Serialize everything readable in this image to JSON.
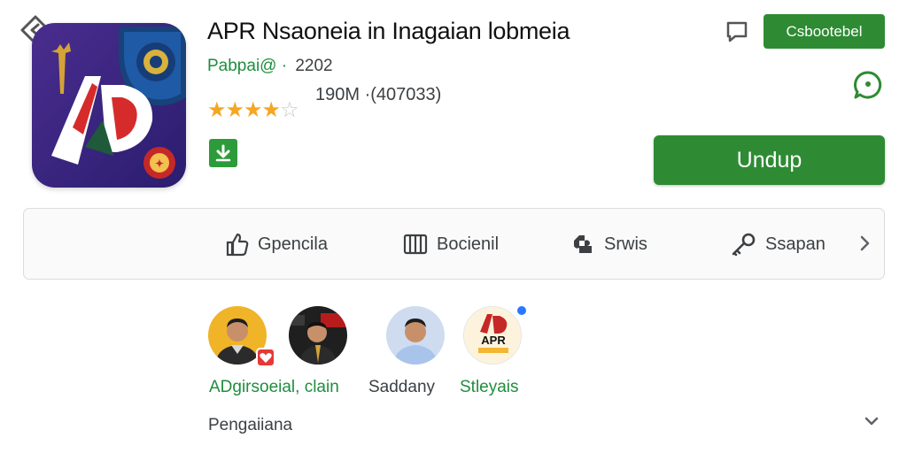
{
  "app": {
    "title": "APR Nsaoneia in Inagaian lobmeia",
    "developer": "Pabpai@",
    "developer_separator": "·",
    "year": "2202",
    "rating_stars": 4.5,
    "reviews": "190M ·(407033)",
    "icon_text": "AD"
  },
  "header": {
    "top_button_label": "Csbootebel",
    "main_button_label": "Undup"
  },
  "actions": [
    {
      "label": "Gpencila",
      "icon": "thumbs-up-icon"
    },
    {
      "label": "Bocienil",
      "icon": "book-icon"
    },
    {
      "label": "Srwis",
      "icon": "puzzle-icon"
    },
    {
      "label": "Ssapan",
      "icon": "key-icon"
    }
  ],
  "people": {
    "labels": [
      {
        "text": "ADgirsoeial, clain",
        "tone": "green"
      },
      {
        "text": "Saddany",
        "tone": "dark"
      },
      {
        "text": "Stleyais",
        "tone": "green"
      }
    ],
    "apr_avatar_text": "APR"
  },
  "footer": {
    "label": "Pengaiiana"
  },
  "colors": {
    "accent_green": "#2e8b33",
    "link_green": "#1e8e3e",
    "star": "#f5a623",
    "icon_bg": "#3b2a8c"
  }
}
